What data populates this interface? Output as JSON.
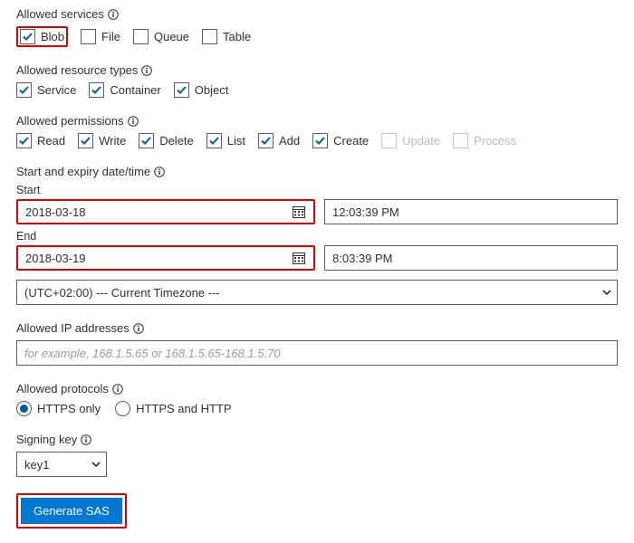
{
  "allowed_services": {
    "title": "Allowed services",
    "items": [
      {
        "label": "Blob",
        "checked": true,
        "highlight": true
      },
      {
        "label": "File",
        "checked": false
      },
      {
        "label": "Queue",
        "checked": false
      },
      {
        "label": "Table",
        "checked": false
      }
    ]
  },
  "allowed_resource_types": {
    "title": "Allowed resource types",
    "items": [
      {
        "label": "Service",
        "checked": true
      },
      {
        "label": "Container",
        "checked": true
      },
      {
        "label": "Object",
        "checked": true
      }
    ]
  },
  "allowed_permissions": {
    "title": "Allowed permissions",
    "items": [
      {
        "label": "Read",
        "checked": true
      },
      {
        "label": "Write",
        "checked": true
      },
      {
        "label": "Delete",
        "checked": true
      },
      {
        "label": "List",
        "checked": true
      },
      {
        "label": "Add",
        "checked": true
      },
      {
        "label": "Create",
        "checked": true
      },
      {
        "label": "Update",
        "checked": false,
        "disabled": true
      },
      {
        "label": "Process",
        "checked": false,
        "disabled": true
      }
    ]
  },
  "datetime": {
    "title": "Start and expiry date/time",
    "start_label": "Start",
    "end_label": "End",
    "start_date": "2018-03-18",
    "start_time": "12:03:39 PM",
    "end_date": "2018-03-19",
    "end_time": "8:03:39 PM",
    "timezone": "(UTC+02:00) --- Current Timezone ---"
  },
  "allowed_ip": {
    "title": "Allowed IP addresses",
    "placeholder": "for example, 168.1.5.65 or 168.1.5.65-168.1.5.70",
    "value": ""
  },
  "allowed_protocols": {
    "title": "Allowed protocols",
    "options": [
      {
        "label": "HTTPS only",
        "selected": true
      },
      {
        "label": "HTTPS and HTTP",
        "selected": false
      }
    ]
  },
  "signing_key": {
    "title": "Signing key",
    "value": "key1"
  },
  "generate_button": "Generate SAS"
}
